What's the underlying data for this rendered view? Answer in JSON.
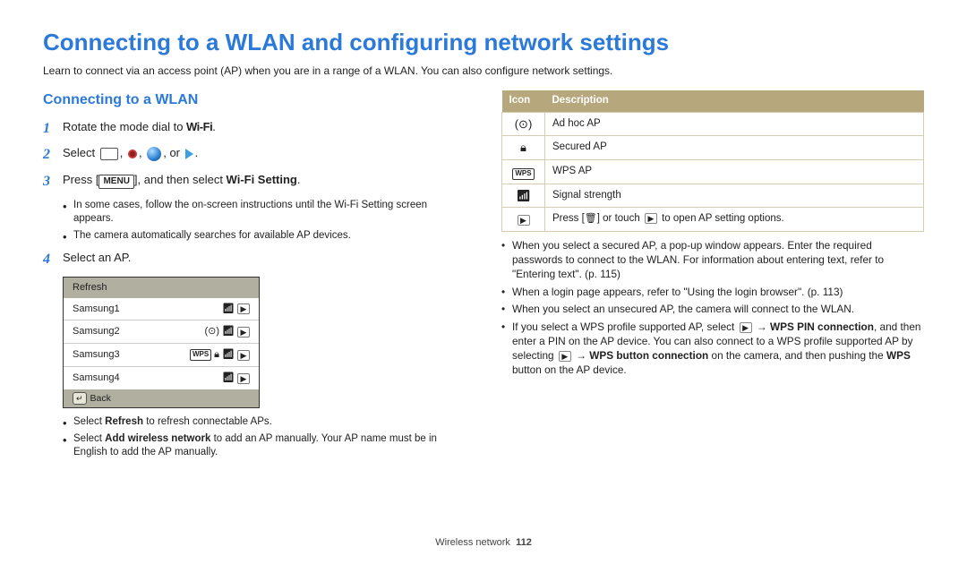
{
  "title": "Connecting to a WLAN and configuring network settings",
  "intro": "Learn to connect via an access point (AP) when you are in a range of a WLAN. You can also configure network settings.",
  "section_heading": "Connecting to a WLAN",
  "steps": {
    "s1": {
      "num": "1",
      "pre": "Rotate the mode dial to ",
      "wifi": "Wi-Fi",
      "post": "."
    },
    "s2": {
      "num": "2",
      "label": "Select ",
      "tail": ", or "
    },
    "s3": {
      "num": "3",
      "pre": "Press [",
      "menu": "MENU",
      "mid": "], and then select ",
      "bold": "Wi-Fi Setting",
      "post": "."
    },
    "s3_bullets": [
      "In some cases, follow the on-screen instructions until the Wi-Fi Setting screen appears.",
      "The camera automatically searches for available AP devices."
    ],
    "s4": {
      "num": "4",
      "label": "Select an AP."
    }
  },
  "ap_list": {
    "refresh": "Refresh",
    "rows": [
      "Samsung1",
      "Samsung2",
      "Samsung3",
      "Samsung4"
    ],
    "back": "Back"
  },
  "step4_bullets_a": "Select ",
  "step4_bullets_a_bold": "Refresh",
  "step4_bullets_a_tail": " to refresh connectable APs.",
  "step4_bullets_b": "Select ",
  "step4_bullets_b_bold": "Add wireless network",
  "step4_bullets_b_tail": " to add an AP manually. Your AP name must be in English to add the AP manually.",
  "icon_table": {
    "head_icon": "Icon",
    "head_desc": "Description",
    "r1": "Ad hoc AP",
    "r2": "Secured AP",
    "r3": "WPS AP",
    "r4": "Signal strength",
    "r5_pre": "Press [",
    "r5_mid": "] or touch ",
    "r5_post": " to open AP setting options."
  },
  "right_bullets": {
    "b1": "When you select a secured AP, a pop-up window appears. Enter the required passwords to connect to the WLAN. For information about entering text, refer to \"Entering text\". (p. 115)",
    "b2": "When a login page appears, refer to \"Using the login browser\". (p. 113)",
    "b3": "When you select an unsecured AP, the camera will connect to the WLAN.",
    "b4_pre": "If you select a WPS profile supported AP, select ",
    "b4_bold1": "WPS PIN connection",
    "b4_mid1": ", and then enter a PIN on the AP device. You can also connect to a WPS profile supported AP by selecting ",
    "b4_bold2": "WPS button connection",
    "b4_mid2": " on the camera, and then pushing the ",
    "b4_bold3": "WPS",
    "b4_tail": " button on the AP device."
  },
  "footer": {
    "section": "Wireless network",
    "page": "112"
  }
}
